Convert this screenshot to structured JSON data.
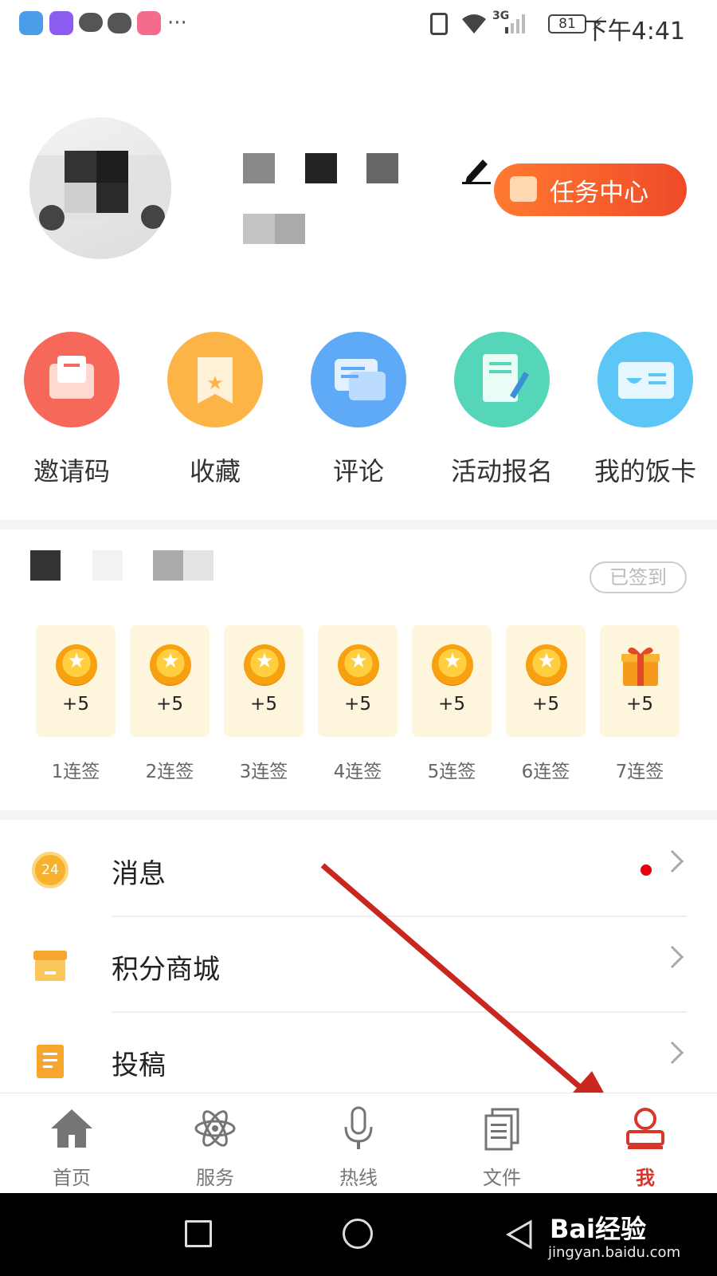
{
  "status_bar": {
    "time": "下午4:41",
    "battery": "81",
    "network": "3G",
    "more": "···"
  },
  "profile": {
    "task_center_label": "任务中心"
  },
  "features": [
    {
      "label": "邀请码",
      "icon": "invite-icon",
      "color": "#f5685a"
    },
    {
      "label": "收藏",
      "icon": "favorite-icon",
      "color": "#fdb447"
    },
    {
      "label": "评论",
      "icon": "comment-icon",
      "color": "#5eaaf7"
    },
    {
      "label": "活动报名",
      "icon": "signup-icon",
      "color": "#56d6b8"
    },
    {
      "label": "我的饭卡",
      "icon": "meal-card-icon",
      "color": "#5cc7f7"
    }
  ],
  "checkin": {
    "signed_label": "已签到",
    "days": [
      {
        "points": "+5",
        "label": "1连签",
        "icon": "coin-icon"
      },
      {
        "points": "+5",
        "label": "2连签",
        "icon": "coin-icon"
      },
      {
        "points": "+5",
        "label": "3连签",
        "icon": "coin-icon"
      },
      {
        "points": "+5",
        "label": "4连签",
        "icon": "coin-icon"
      },
      {
        "points": "+5",
        "label": "5连签",
        "icon": "coin-icon"
      },
      {
        "points": "+5",
        "label": "6连签",
        "icon": "coin-icon"
      },
      {
        "points": "+5",
        "label": "7连签",
        "icon": "gift-icon"
      }
    ]
  },
  "menu": [
    {
      "label": "消息",
      "icon": "message-icon",
      "badge_number": "24",
      "has_dot": true
    },
    {
      "label": "积分商城",
      "icon": "shop-icon"
    },
    {
      "label": "投稿",
      "icon": "submit-icon"
    }
  ],
  "tabbar": [
    {
      "label": "首页",
      "icon": "home-icon"
    },
    {
      "label": "服务",
      "icon": "atom-icon"
    },
    {
      "label": "热线",
      "icon": "microphone-icon"
    },
    {
      "label": "文件",
      "icon": "document-icon"
    },
    {
      "label": "我",
      "icon": "user-icon",
      "active": true
    }
  ],
  "watermark": {
    "brand": "Bai经验",
    "url": "jingyan.baidu.com"
  },
  "colors": {
    "accent": "#d9362b",
    "task_gradient_start": "#ff7a2f",
    "task_gradient_end": "#ef4a2a"
  }
}
